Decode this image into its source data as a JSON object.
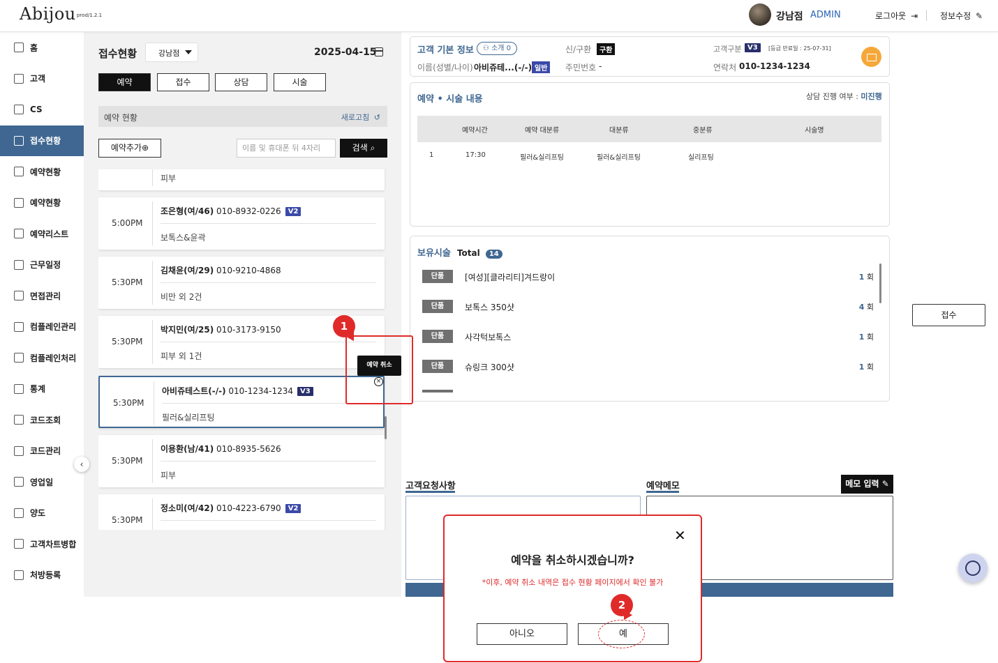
{
  "header": {
    "logo": "Abijou",
    "version": "prod/1.2.1",
    "user_name": "강남점",
    "user_role": "ADMIN",
    "logout": "로그아웃",
    "edit_info": "정보수정"
  },
  "sidebar": {
    "items": [
      {
        "label": "홈",
        "icon": "home-icon"
      },
      {
        "label": "고객",
        "icon": "user-icon"
      },
      {
        "label": "CS",
        "icon": "document-icon"
      },
      {
        "label": "접수현황",
        "icon": "reception-icon",
        "active": true
      },
      {
        "label": "예약현황",
        "icon": "calendar-icon"
      },
      {
        "label": "예약현황",
        "icon": "calendar-grid-icon"
      },
      {
        "label": "예약리스트",
        "icon": "list-icon"
      },
      {
        "label": "근무일정",
        "icon": "schedule-icon"
      },
      {
        "label": "면접관리",
        "icon": "interview-icon"
      },
      {
        "label": "컴플레인관리",
        "icon": "face-icon"
      },
      {
        "label": "컴플레인처리",
        "icon": "smile-icon"
      },
      {
        "label": "통계",
        "icon": "chart-icon"
      },
      {
        "label": "코드조회",
        "icon": "tree-icon"
      },
      {
        "label": "코드관리",
        "icon": "tree-icon"
      },
      {
        "label": "영업일",
        "icon": "calendar-icon"
      },
      {
        "label": "양도",
        "icon": "transfer-icon"
      },
      {
        "label": "고객차트병합",
        "icon": "merge-icon"
      },
      {
        "label": "처방등록",
        "icon": "prescription-icon"
      }
    ]
  },
  "reception": {
    "title": "접수현황",
    "store": "강남점",
    "date": "2025-04-15",
    "tabs": [
      "예약",
      "접수",
      "상담",
      "시술"
    ],
    "section_title": "예약 현황",
    "refresh": "새로고침",
    "add_label": "예약추가",
    "search_placeholder": "이름 및 휴대폰 뒤 4자리",
    "search_label": "검색"
  },
  "cards": [
    {
      "time": "",
      "name": "",
      "phone": "",
      "badge": "",
      "procedure": "피부"
    },
    {
      "time": "5:00PM",
      "name": "조은형(여/46)",
      "phone": "010-8932-0226",
      "badge": "V2",
      "procedure": "보톡스&윤곽"
    },
    {
      "time": "5:30PM",
      "name": "김채윤(여/29)",
      "phone": "010-9210-4868",
      "badge": "",
      "procedure": "비만 외 2건"
    },
    {
      "time": "5:30PM",
      "name": "박지민(여/25)",
      "phone": "010-3173-9150",
      "badge": "",
      "procedure": "피부 외 1건"
    },
    {
      "time": "5:30PM",
      "name": "아비쥬테스트(-/-)",
      "phone": "010-1234-1234",
      "badge": "V3",
      "procedure": "필러&실리프팅",
      "selected": true
    },
    {
      "time": "5:30PM",
      "name": "이용환(남/41)",
      "phone": "010-8935-5626",
      "badge": "",
      "procedure": "피부"
    },
    {
      "time": "5:30PM",
      "name": "정소미(여/42)",
      "phone": "010-4223-6790",
      "badge": "V2",
      "procedure": ""
    }
  ],
  "tooltip": {
    "cancel": "예약 취소"
  },
  "customer": {
    "title": "고객 기본 정보",
    "intro": "소개 0",
    "new_old_label": "신/구환",
    "new_old_value": "구환",
    "grade_label": "고객구분",
    "grade_value": "V3",
    "grade_expiry": "[등급 만료일 : 25-07-31]",
    "name_label": "이름(성별/나이)",
    "name_value": "아비쥬테...(-/-)",
    "name_badge": "일반",
    "rrn_label": "주민번호",
    "rrn_value": "-",
    "contact_label": "연락처",
    "contact_value": "010-1234-1234"
  },
  "reservation": {
    "title": "예약 • 시술 내용",
    "consult_label": "상담 진행 여부 :",
    "consult_value": "미진행",
    "columns": [
      "예약시간",
      "예약 대분류",
      "대분류",
      "중분류",
      "시술명"
    ],
    "rows": [
      [
        "1",
        "17:30",
        "필러&실리프팅",
        "필러&실리프팅",
        "실리프팅",
        ""
      ]
    ]
  },
  "holdings": {
    "title": "보유시술",
    "total_label": "Total",
    "total": "14",
    "tag": "단품",
    "unit": "회",
    "items": [
      {
        "name": "[여성][클라리티]겨드랑이",
        "count": "1"
      },
      {
        "name": "보톡스 350샷",
        "count": "4"
      },
      {
        "name": "사각턱보톡스",
        "count": "1"
      },
      {
        "name": "슈링크 300샷",
        "count": "1"
      }
    ]
  },
  "side_action": {
    "accept": "접수"
  },
  "memo": {
    "request_label": "고객요청사항",
    "memo_label": "예약메모",
    "memo_button": "메모 입력"
  },
  "modal": {
    "title": "예약을 취소하시겠습니까?",
    "note": "*이후, 예약 취소 내역은 접수 현황 페이지에서 확인 불가",
    "no": "아니오",
    "yes": "예"
  },
  "steps": [
    "1",
    "2"
  ],
  "colors": {
    "primary": "#3f6791",
    "danger": "#e02a2a",
    "accent": "#f5a83a"
  }
}
